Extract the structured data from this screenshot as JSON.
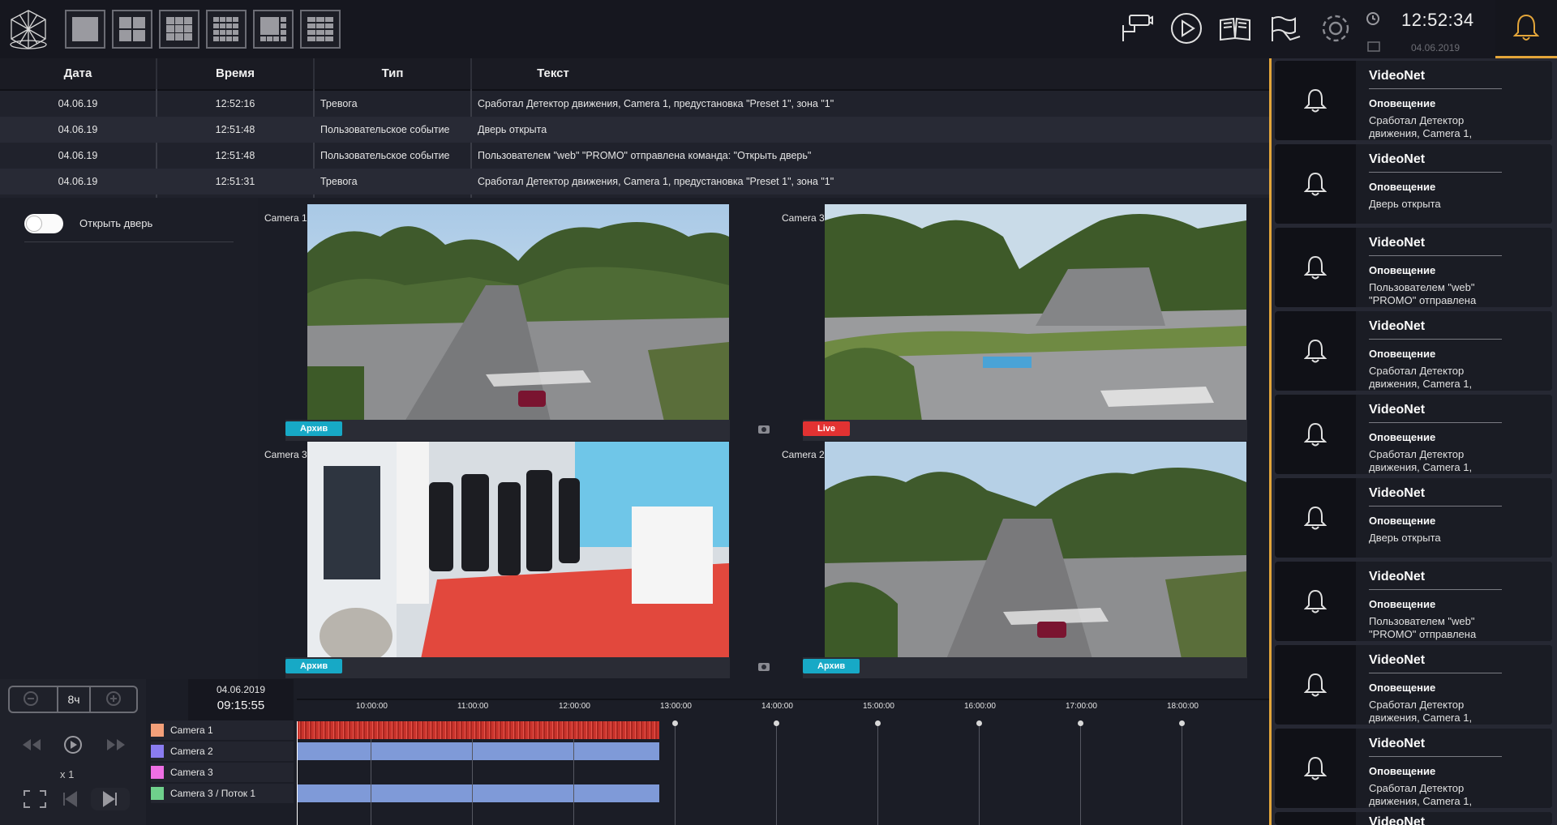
{
  "header": {
    "clock_time": "12:52:34",
    "clock_date": "04.06.2019",
    "layout_buttons": [
      "layout-1x1",
      "layout-2x2",
      "layout-3x3",
      "layout-4x4",
      "layout-1-plus-7",
      "layout-3x4"
    ],
    "toolbar_icons": [
      "camera-icon",
      "play-icon",
      "book-icon",
      "flags-icon",
      "gear-icon"
    ],
    "accent_color": "#e3a53a"
  },
  "events": {
    "columns": [
      "Дата",
      "Время",
      "Тип",
      "Текст"
    ],
    "rows": [
      {
        "date": "04.06.19",
        "time": "12:52:16",
        "type": "Тревога",
        "text": "Сработал Детектор движения, Camera 1, предустановка \"Preset 1\", зона \"1\""
      },
      {
        "date": "04.06.19",
        "time": "12:51:48",
        "type": "Пользовательское событие",
        "text": "Дверь открыта"
      },
      {
        "date": "04.06.19",
        "time": "12:51:48",
        "type": "Пользовательское событие",
        "text": "Пользователем \"web\" \"PROMO\" отправлена команда: \"Открыть дверь\""
      },
      {
        "date": "04.06.19",
        "time": "12:51:31",
        "type": "Тревога",
        "text": "Сработал Детектор движения, Camera 1, предустановка \"Preset 1\", зона \"1\""
      }
    ]
  },
  "left_panel": {
    "toggle_label": "Открыть дверь",
    "toggle_on": false
  },
  "cameras": [
    {
      "label": "Camera 1",
      "badge": "Архив",
      "mode": "archive"
    },
    {
      "label": "Camera 3",
      "badge": "Live",
      "mode": "live"
    },
    {
      "label": "Camera 3",
      "badge": "Архив",
      "mode": "archive"
    },
    {
      "label": "Camera 2",
      "badge": "Архив",
      "mode": "archive"
    }
  ],
  "timeline": {
    "zoom": "8ч",
    "speed": "x 1",
    "date": "04.06.2019",
    "time": "09:15:55",
    "ticks": [
      "10:00:00",
      "11:00:00",
      "12:00:00",
      "13:00:00",
      "14:00:00",
      "15:00:00",
      "16:00:00",
      "17:00:00",
      "18:00:00"
    ],
    "tracks": [
      {
        "name": "Camera 1",
        "color": "#f4a07a"
      },
      {
        "name": "Camera 2",
        "color": "#8a7cf0"
      },
      {
        "name": "Camera 3",
        "color": "#ee6fe4"
      },
      {
        "name": "Camera 3 / Поток 1",
        "color": "#6fd08c"
      }
    ]
  },
  "notifications": [
    {
      "title": "VideoNet",
      "subtitle": "Оповещение",
      "message": "Сработал Детектор движения, Camera 1,"
    },
    {
      "title": "VideoNet",
      "subtitle": "Оповещение",
      "message": "Дверь открыта"
    },
    {
      "title": "VideoNet",
      "subtitle": "Оповещение",
      "message": "Пользователем \"web\" \"PROMO\" отправлена"
    },
    {
      "title": "VideoNet",
      "subtitle": "Оповещение",
      "message": "Сработал Детектор движения, Camera 1,"
    },
    {
      "title": "VideoNet",
      "subtitle": "Оповещение",
      "message": "Сработал Детектор движения, Camera 1,"
    },
    {
      "title": "VideoNet",
      "subtitle": "Оповещение",
      "message": "Дверь открыта"
    },
    {
      "title": "VideoNet",
      "subtitle": "Оповещение",
      "message": "Пользователем \"web\" \"PROMO\" отправлена"
    },
    {
      "title": "VideoNet",
      "subtitle": "Оповещение",
      "message": "Сработал Детектор движения, Camera 1,"
    },
    {
      "title": "VideoNet",
      "subtitle": "Оповещение",
      "message": "Сработал Детектор движения, Camera 1,"
    },
    {
      "title": "VideoNet",
      "subtitle": "",
      "message": ""
    }
  ]
}
